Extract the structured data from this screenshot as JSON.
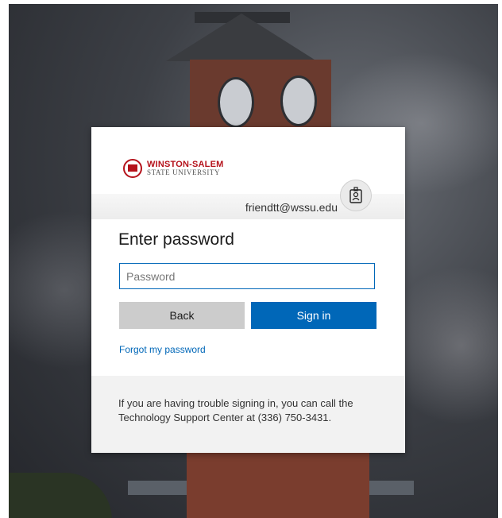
{
  "logo": {
    "name": "WINSTON-SALEM",
    "sub": "STATE UNIVERSITY",
    "color": "#b5121b"
  },
  "identity": {
    "email": "friendtt@wssu.edu",
    "avatar_icon": "badge-person-icon"
  },
  "form": {
    "title": "Enter password",
    "password_placeholder": "Password",
    "password_value": "",
    "back_label": "Back",
    "signin_label": "Sign in",
    "forgot_label": "Forgot my password"
  },
  "footer": {
    "text": "If you are having trouble signing in, you can call the Technology Support Center at (336) 750-3431."
  },
  "colors": {
    "accent": "#0067b8",
    "back_button": "#cccccc"
  }
}
